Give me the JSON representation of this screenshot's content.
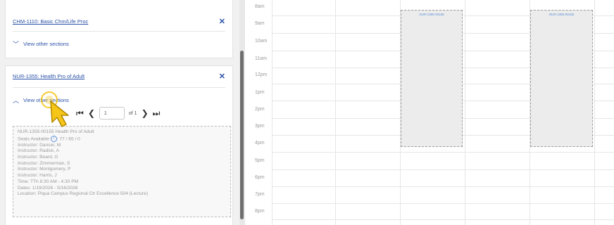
{
  "sidebar": {
    "courses": [
      {
        "title": "CHM-1110: Basic Chm/Life Proc",
        "toggle": "View other sections",
        "close": "✕"
      },
      {
        "title": "NUR-1355: Health Pro of Adult",
        "toggle": "View other sections",
        "close": "✕"
      }
    ],
    "pager": {
      "page": "1",
      "of": "of 1"
    },
    "section": {
      "name": "NUR-1355-00155 Health Pro of Adult",
      "seats_label": "Seats Available",
      "seats_value": ": 77 / 65 / 0",
      "instructors": [
        "Instructor: Dancer, M",
        "Instructor: Radick, A",
        "Instructor: Beard, G",
        "Instructor: Zimmerman, S",
        "Instructor: Montgomery, P",
        "Instructor: Harris, J"
      ],
      "time": "Time: TTh 8:30 AM - 4:30 PM",
      "dates": "Dates: 1/19/2026 - 5/16/2026",
      "location": "Location: Piqua Campus Regional Ctr Excellence 504 (Lecture)"
    }
  },
  "calendar": {
    "hours": [
      "8am",
      "9am",
      "10am",
      "11am",
      "12pm",
      "1pm",
      "2pm",
      "3pm",
      "4pm",
      "5pm",
      "6pm",
      "7pm",
      "8pm"
    ],
    "events": [
      {
        "title": "NUR-1355-00155"
      },
      {
        "title": "NUR-1355-00155"
      }
    ]
  },
  "colors": {
    "link": "#2b52a8",
    "highlight": "#f5c518"
  }
}
